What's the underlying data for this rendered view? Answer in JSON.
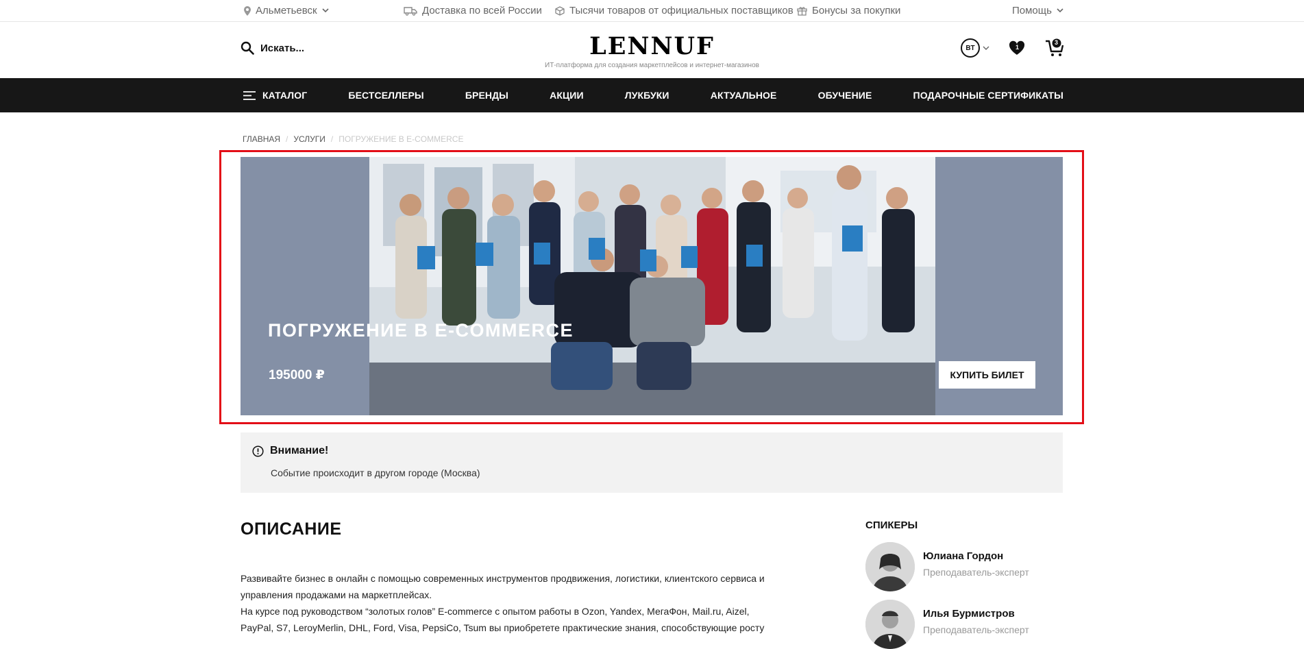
{
  "topbar": {
    "city": "Альметьевск",
    "delivery": "Доставка по всей России",
    "goods": "Тысячи товаров от официальных поставщиков",
    "bonuses": "Бонусы за покупки",
    "help": "Помощь"
  },
  "header": {
    "search_placeholder": "Искать...",
    "logo": "LENNUF",
    "tagline": "ИТ-платформа для создания маркетплейсов и интернет-магазинов",
    "lang": "BT",
    "wishlist_count": "1",
    "cart_count": "3"
  },
  "nav": {
    "items": [
      "КАТАЛОГ",
      "БЕСТСЕЛЛЕРЫ",
      "БРЕНДЫ",
      "АКЦИИ",
      "ЛУКБУКИ",
      "АКТУАЛЬНОЕ",
      "ОБУЧЕНИЕ",
      "ПОДАРОЧНЫЕ СЕРТИФИКАТЫ"
    ]
  },
  "breadcrumbs": [
    "ГЛАВНАЯ",
    "УСЛУГИ",
    "ПОГРУЖЕНИЕ В E-COMMERCE"
  ],
  "hero": {
    "title": "ПОГРУЖЕНИЕ В E-COMMERCE",
    "price": "195000 ₽",
    "buy_label": "КУПИТЬ БИЛЕТ"
  },
  "notice": {
    "title": "Внимание!",
    "text": "Событие происходит в другом городе (Москва)"
  },
  "description": {
    "title": "ОПИСАНИЕ",
    "line1": "Развивайте бизнес в онлайн с помощью современных инструментов продвижения, логистики, клиентского сервиса и управления продажами на маркетплейсах.",
    "line2": "На курсе под руководством “золотых голов” E-commerce с опытом работы в Ozon, Yandex, МегаФон, Mail.ru, Aizel, PayPal, S7, LeroyMerlin, DHL, Ford, Visa, PepsiCo, Tsum вы приобретете практические знания, способствующие росту"
  },
  "speakers": {
    "title": "СПИКЕРЫ",
    "list": [
      {
        "name": "Юлиана Гордон",
        "role": "Преподаватель-эксперт"
      },
      {
        "name": "Илья Бурмистров",
        "role": "Преподаватель-эксперт"
      }
    ]
  },
  "colors": {
    "nav_bg": "#171717",
    "hero_bg": "#8490a6",
    "highlight_frame": "#e30e17",
    "notice_bg": "#f2f2f2"
  }
}
